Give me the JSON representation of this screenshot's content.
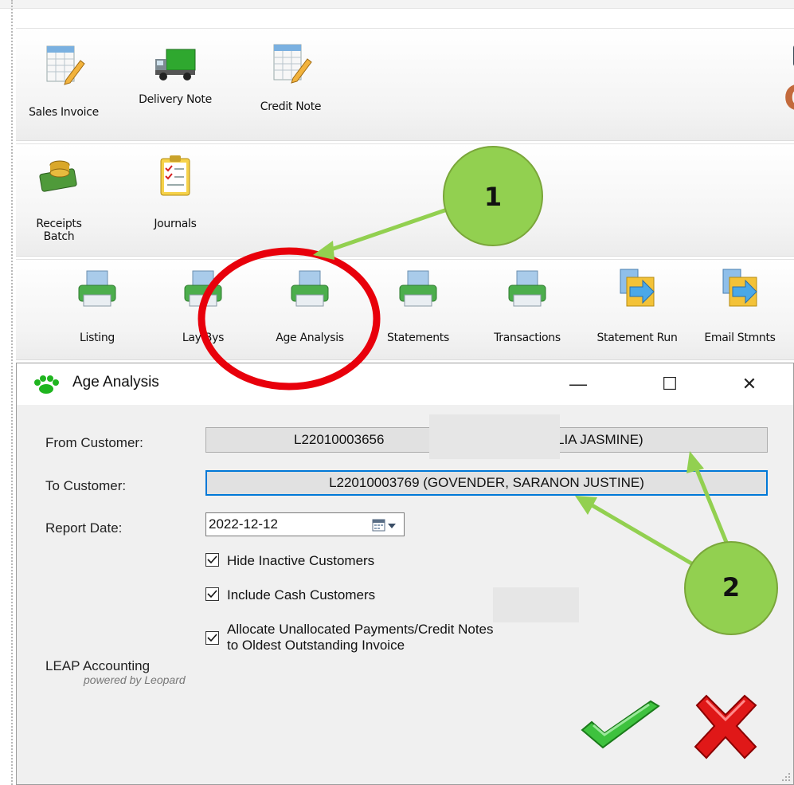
{
  "toolbar": {
    "row1": [
      {
        "label": "Sales Invoice",
        "icon": "spreadsheet-pencil-icon"
      },
      {
        "label": "Delivery Note",
        "icon": "truck-icon"
      },
      {
        "label": "Credit Note",
        "icon": "spreadsheet-pencil-icon"
      }
    ],
    "row2": [
      {
        "label": "Receipts Batch",
        "icon": "money-icon"
      },
      {
        "label": "Journals",
        "icon": "clipboard-checklist-icon"
      }
    ],
    "row3": [
      {
        "label": "Listing",
        "icon": "printer-icon"
      },
      {
        "label": "Lay Bys",
        "icon": "printer-icon"
      },
      {
        "label": "Age Analysis",
        "icon": "printer-icon"
      },
      {
        "label": "Statements",
        "icon": "printer-icon"
      },
      {
        "label": "Transactions",
        "icon": "printer-icon"
      },
      {
        "label": "Statement Run",
        "icon": "folder-arrow-icon"
      },
      {
        "label": "Email Stmnts",
        "icon": "folder-arrow-icon"
      }
    ]
  },
  "dialog": {
    "title": "Age Analysis",
    "window_buttons": {
      "minimize": "—",
      "maximize": "☐",
      "close": "✕"
    },
    "from_label": "From Customer:",
    "from_value_left": "L22010003656",
    "from_value_right": "LIA JASMINE)",
    "to_label": "To Customer:",
    "to_value": "L22010003769 (GOVENDER, SARANON JUSTINE)",
    "date_label": "Report Date:",
    "date_value": "2022-12-12",
    "options": [
      {
        "label": "Hide Inactive Customers",
        "checked": true
      },
      {
        "label": "Include Cash Customers",
        "checked": true
      },
      {
        "label_line1": "Allocate Unallocated Payments/Credit Notes",
        "label_line2": "to Oldest Outstanding Invoice",
        "checked": true
      }
    ],
    "footer_name": "LEAP Accounting",
    "footer_sub": "powered by Leopard"
  },
  "annotations": {
    "callout1": "1",
    "callout2": "2",
    "circle_color": "#e8000b",
    "callout_fill": "#92d050",
    "arrow_color": "#92d050"
  }
}
